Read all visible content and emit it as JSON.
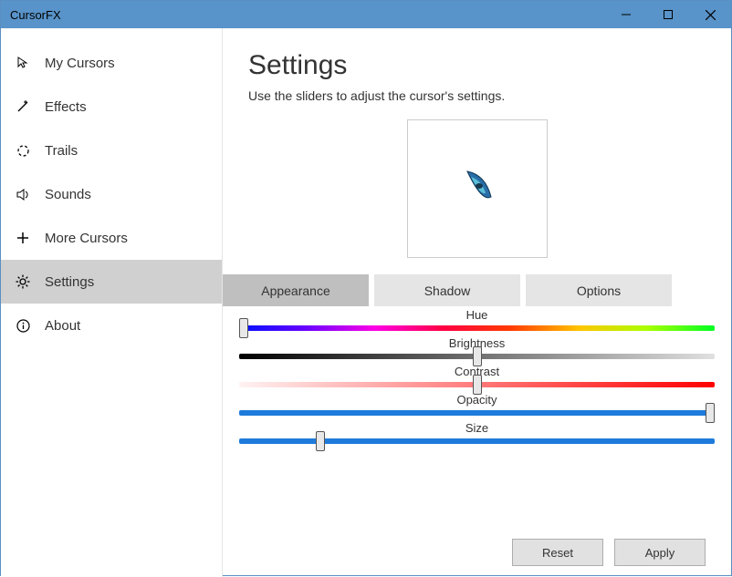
{
  "window": {
    "title": "CursorFX"
  },
  "sidebar": {
    "items": [
      {
        "label": "My Cursors"
      },
      {
        "label": "Effects"
      },
      {
        "label": "Trails"
      },
      {
        "label": "Sounds"
      },
      {
        "label": "More Cursors"
      },
      {
        "label": "Settings"
      },
      {
        "label": "About"
      }
    ]
  },
  "page": {
    "title": "Settings",
    "description": "Use the sliders to adjust the cursor's settings."
  },
  "tabs": [
    {
      "label": "Appearance"
    },
    {
      "label": "Shadow"
    },
    {
      "label": "Options"
    }
  ],
  "sliders": {
    "hue": {
      "label": "Hue",
      "value": 0
    },
    "brightness": {
      "label": "Brightness",
      "value": 50
    },
    "contrast": {
      "label": "Contrast",
      "value": 50
    },
    "opacity": {
      "label": "Opacity",
      "value": 100
    },
    "size": {
      "label": "Size",
      "value": 17
    }
  },
  "buttons": {
    "reset": "Reset",
    "apply": "Apply"
  }
}
